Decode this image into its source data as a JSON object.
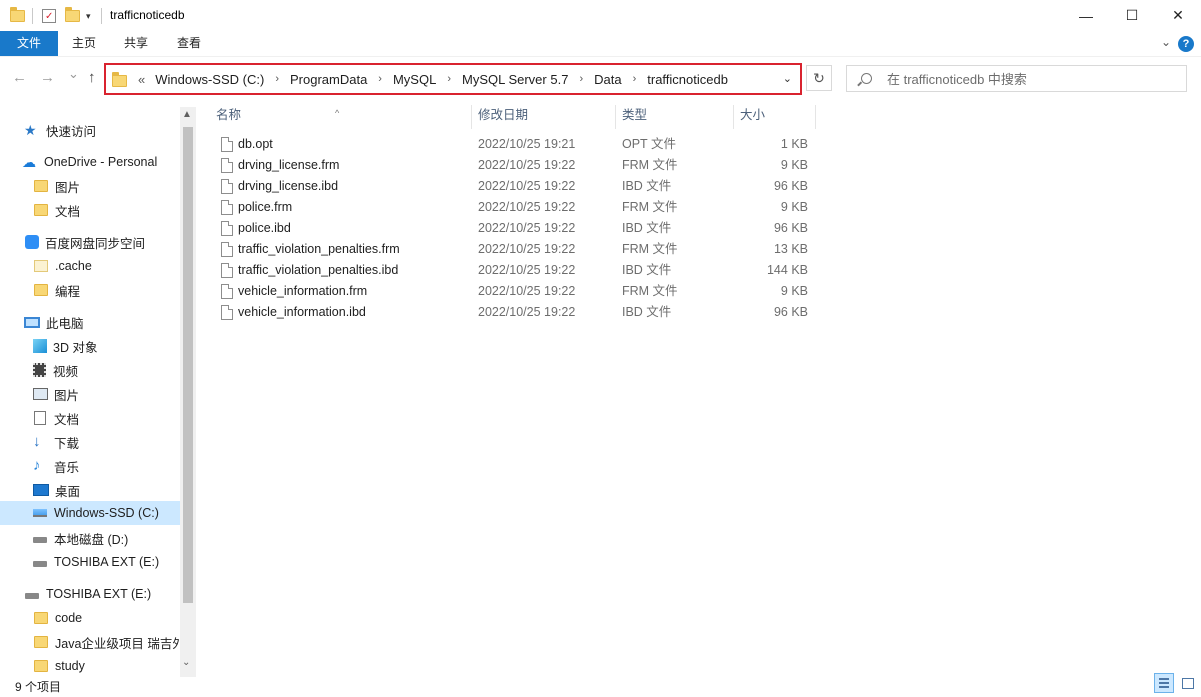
{
  "window": {
    "title": "trafficnoticedb",
    "controls": {
      "minimize": "—",
      "maximize": "☐",
      "close": "✕"
    }
  },
  "ribbon": {
    "tabs": [
      "文件",
      "主页",
      "共享",
      "查看"
    ],
    "help": "?",
    "accent": "#1979ca"
  },
  "nav": {
    "back": "←",
    "forward": "→",
    "recent": "⌄",
    "up": "↑"
  },
  "address": {
    "overflow": "«",
    "crumbs": [
      "Windows-SSD (C:)",
      "ProgramData",
      "MySQL",
      "MySQL Server 5.7",
      "Data",
      "trafficnoticedb"
    ],
    "highlight_color": "#d9232f",
    "refresh": "↻"
  },
  "search": {
    "placeholder": "在 trafficnoticedb 中搜索"
  },
  "sidebar": {
    "items": [
      {
        "label": "快速访问",
        "icon": "star-icon"
      },
      {
        "label": "OneDrive - Personal",
        "icon": "cloud-icon"
      },
      {
        "label": "图片",
        "icon": "folder-icon"
      },
      {
        "label": "文档",
        "icon": "folder-icon"
      },
      {
        "label": "百度网盘同步空间",
        "icon": "baidu-netdisk-icon"
      },
      {
        "label": ".cache",
        "icon": "folder-icon"
      },
      {
        "label": "编程",
        "icon": "folder-icon"
      },
      {
        "label": "此电脑",
        "icon": "computer-icon"
      },
      {
        "label": "3D 对象",
        "icon": "3d-objects-icon"
      },
      {
        "label": "视频",
        "icon": "video-icon"
      },
      {
        "label": "图片",
        "icon": "pictures-icon"
      },
      {
        "label": "文档",
        "icon": "documents-icon"
      },
      {
        "label": "下载",
        "icon": "download-icon"
      },
      {
        "label": "音乐",
        "icon": "music-icon"
      },
      {
        "label": "桌面",
        "icon": "desktop-icon"
      },
      {
        "label": "Windows-SSD (C:)",
        "icon": "windows-drive-icon"
      },
      {
        "label": "本地磁盘 (D:)",
        "icon": "drive-icon"
      },
      {
        "label": "TOSHIBA EXT (E:)",
        "icon": "drive-icon"
      },
      {
        "label": "TOSHIBA EXT (E:)",
        "icon": "drive-icon"
      },
      {
        "label": "code",
        "icon": "folder-icon"
      },
      {
        "label": "Java企业级项目 瑞吉外",
        "icon": "folder-icon"
      },
      {
        "label": "study",
        "icon": "folder-icon"
      }
    ],
    "selected": "Windows-SSD (C:)"
  },
  "columns": {
    "name": "名称",
    "date": "修改日期",
    "type": "类型",
    "size": "大小"
  },
  "files": [
    {
      "name": "db.opt",
      "date": "2022/10/25 19:21",
      "type": "OPT 文件",
      "size": "1 KB"
    },
    {
      "name": "drving_license.frm",
      "date": "2022/10/25 19:22",
      "type": "FRM 文件",
      "size": "9 KB"
    },
    {
      "name": "drving_license.ibd",
      "date": "2022/10/25 19:22",
      "type": "IBD 文件",
      "size": "96 KB"
    },
    {
      "name": "police.frm",
      "date": "2022/10/25 19:22",
      "type": "FRM 文件",
      "size": "9 KB"
    },
    {
      "name": "police.ibd",
      "date": "2022/10/25 19:22",
      "type": "IBD 文件",
      "size": "96 KB"
    },
    {
      "name": "traffic_violation_penalties.frm",
      "date": "2022/10/25 19:22",
      "type": "FRM 文件",
      "size": "13 KB"
    },
    {
      "name": "traffic_violation_penalties.ibd",
      "date": "2022/10/25 19:22",
      "type": "IBD 文件",
      "size": "144 KB"
    },
    {
      "name": "vehicle_information.frm",
      "date": "2022/10/25 19:22",
      "type": "FRM 文件",
      "size": "9 KB"
    },
    {
      "name": "vehicle_information.ibd",
      "date": "2022/10/25 19:22",
      "type": "IBD 文件",
      "size": "96 KB"
    }
  ],
  "status": {
    "item_count": "9 个项目"
  }
}
